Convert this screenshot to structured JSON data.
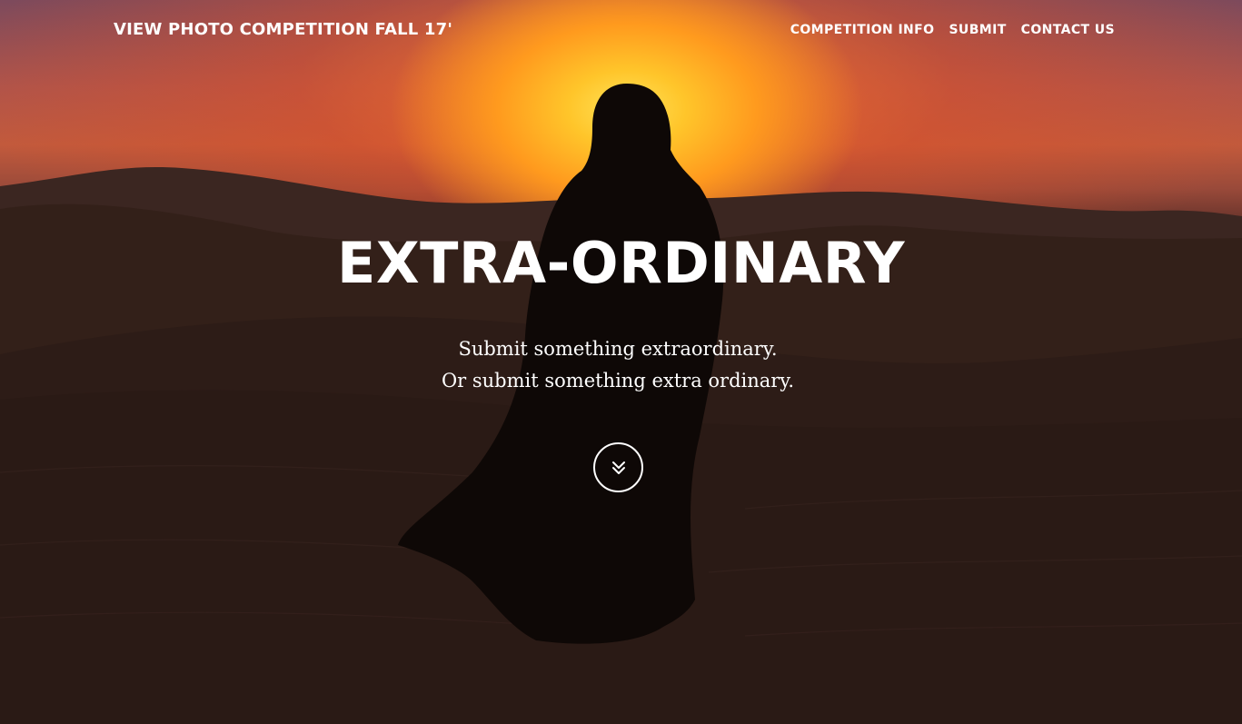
{
  "nav": {
    "brand": "VIEW PHOTO COMPETITION FALL 17'",
    "links": [
      {
        "label": "COMPETITION INFO"
      },
      {
        "label": "SUBMIT"
      },
      {
        "label": "CONTACT US"
      }
    ]
  },
  "hero": {
    "title": "EXTRA-ORDINARY",
    "subtitle_line1": "Submit something extraordinary.",
    "subtitle_line2": "Or submit something extra ordinary.",
    "scroll_icon": "double-chevron-down-icon"
  },
  "colors": {
    "text": "#ffffff",
    "sun": "#ffc52a",
    "sky_top": "#7d4a5c",
    "sand": "#2a1a16"
  }
}
